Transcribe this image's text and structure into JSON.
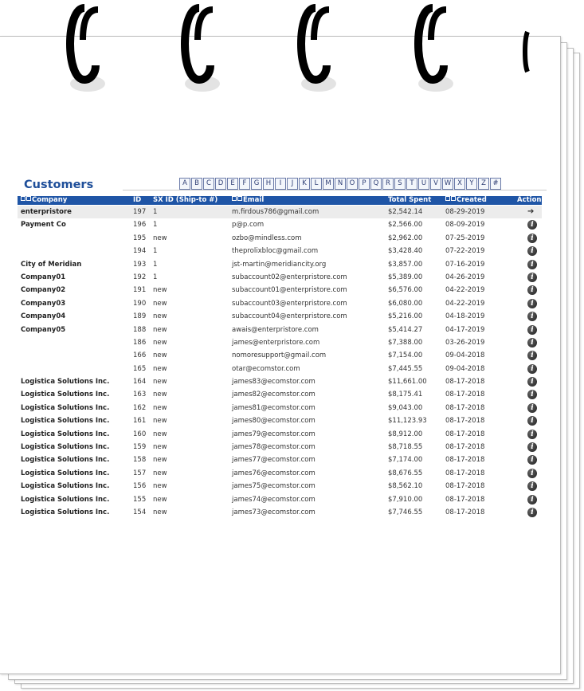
{
  "page": {
    "title": "Customers"
  },
  "alphabet": [
    "A",
    "B",
    "C",
    "D",
    "E",
    "F",
    "G",
    "H",
    "I",
    "J",
    "K",
    "L",
    "M",
    "N",
    "O",
    "P",
    "Q",
    "R",
    "S",
    "T",
    "U",
    "V",
    "W",
    "X",
    "Y",
    "Z",
    "#"
  ],
  "table": {
    "columns": {
      "company": "Company",
      "id": "ID",
      "sx_id": "SX ID (Ship-to #)",
      "email": "Email",
      "total_spent": "Total Spent",
      "created": "Created",
      "action": "Action"
    },
    "rows": [
      {
        "company": "enterpristore",
        "id": "197",
        "sx": "1",
        "email": "m.firdous786@gmail.com",
        "total": "$2,542.14",
        "created": "08-29-2019",
        "action": "arrow-right-icon"
      },
      {
        "company": "Payment Co",
        "id": "196",
        "sx": "1",
        "email": "p@p.com",
        "total": "$2,566.00",
        "created": "08-09-2019",
        "action": "info-icon"
      },
      {
        "company": "",
        "id": "195",
        "sx": "new",
        "email": "ozbo@mindless.com",
        "total": "$2,962.00",
        "created": "07-25-2019",
        "action": "info-icon"
      },
      {
        "company": "",
        "id": "194",
        "sx": "1",
        "email": "theprolixbloc@gmail.com",
        "total": "$3,428.40",
        "created": "07-22-2019",
        "action": "info-icon"
      },
      {
        "company": "City of Meridian",
        "id": "193",
        "sx": "1",
        "email": "jst-martin@meridiancity.org",
        "total": "$3,857.00",
        "created": "07-16-2019",
        "action": "info-icon"
      },
      {
        "company": "Company01",
        "id": "192",
        "sx": "1",
        "email": "subaccount02@enterpristore.com",
        "total": "$5,389.00",
        "created": "04-26-2019",
        "action": "info-icon"
      },
      {
        "company": "Company02",
        "id": "191",
        "sx": "new",
        "email": "subaccount01@enterpristore.com",
        "total": "$6,576.00",
        "created": "04-22-2019",
        "action": "info-icon"
      },
      {
        "company": "Company03",
        "id": "190",
        "sx": "new",
        "email": "subaccount03@enterpristore.com",
        "total": "$6,080.00",
        "created": "04-22-2019",
        "action": "info-icon"
      },
      {
        "company": "Company04",
        "id": "189",
        "sx": "new",
        "email": "subaccount04@enterpristore.com",
        "total": "$5,216.00",
        "created": "04-18-2019",
        "action": "info-icon"
      },
      {
        "company": "Company05",
        "id": "188",
        "sx": "new",
        "email": "awais@enterpristore.com",
        "total": "$5,414.27",
        "created": "04-17-2019",
        "action": "info-icon"
      },
      {
        "company": "",
        "id": "186",
        "sx": "new",
        "email": "james@enterpristore.com",
        "total": "$7,388.00",
        "created": "03-26-2019",
        "action": "info-icon"
      },
      {
        "company": "",
        "id": "166",
        "sx": "new",
        "email": "nomoresupport@gmail.com",
        "total": "$7,154.00",
        "created": "09-04-2018",
        "action": "info-icon"
      },
      {
        "company": "",
        "id": "165",
        "sx": "new",
        "email": "otar@ecomstor.com",
        "total": "$7,445.55",
        "created": "09-04-2018",
        "action": "info-icon"
      },
      {
        "company": "Logistica Solutions Inc.",
        "id": "164",
        "sx": "new",
        "email": "james83@ecomstor.com",
        "total": "$11,661.00",
        "created": "08-17-2018",
        "action": "info-icon"
      },
      {
        "company": "Logistica Solutions Inc.",
        "id": "163",
        "sx": "new",
        "email": "james82@ecomstor.com",
        "total": "$8,175.41",
        "created": "08-17-2018",
        "action": "info-icon"
      },
      {
        "company": "Logistica Solutions Inc.",
        "id": "162",
        "sx": "new",
        "email": "james81@ecomstor.com",
        "total": "$9,043.00",
        "created": "08-17-2018",
        "action": "info-icon"
      },
      {
        "company": "Logistica Solutions Inc.",
        "id": "161",
        "sx": "new",
        "email": "james80@ecomstor.com",
        "total": "$11,123.93",
        "created": "08-17-2018",
        "action": "info-icon"
      },
      {
        "company": "Logistica Solutions Inc.",
        "id": "160",
        "sx": "new",
        "email": "james79@ecomstor.com",
        "total": "$8,912.00",
        "created": "08-17-2018",
        "action": "info-icon"
      },
      {
        "company": "Logistica Solutions Inc.",
        "id": "159",
        "sx": "new",
        "email": "james78@ecomstor.com",
        "total": "$8,718.55",
        "created": "08-17-2018",
        "action": "info-icon"
      },
      {
        "company": "Logistica Solutions Inc.",
        "id": "158",
        "sx": "new",
        "email": "james77@ecomstor.com",
        "total": "$7,174.00",
        "created": "08-17-2018",
        "action": "info-icon"
      },
      {
        "company": "Logistica Solutions Inc.",
        "id": "157",
        "sx": "new",
        "email": "james76@ecomstor.com",
        "total": "$8,676.55",
        "created": "08-17-2018",
        "action": "info-icon"
      },
      {
        "company": "Logistica Solutions Inc.",
        "id": "156",
        "sx": "new",
        "email": "james75@ecomstor.com",
        "total": "$8,562.10",
        "created": "08-17-2018",
        "action": "info-icon"
      },
      {
        "company": "Logistica Solutions Inc.",
        "id": "155",
        "sx": "new",
        "email": "james74@ecomstor.com",
        "total": "$7,910.00",
        "created": "08-17-2018",
        "action": "info-icon"
      },
      {
        "company": "Logistica Solutions Inc.",
        "id": "154",
        "sx": "new",
        "email": "james73@ecomstor.com",
        "total": "$7,746.55",
        "created": "08-17-2018",
        "action": "info-icon"
      }
    ]
  },
  "colors": {
    "header_bg": "#1f55a6",
    "title": "#1f4f9a"
  }
}
